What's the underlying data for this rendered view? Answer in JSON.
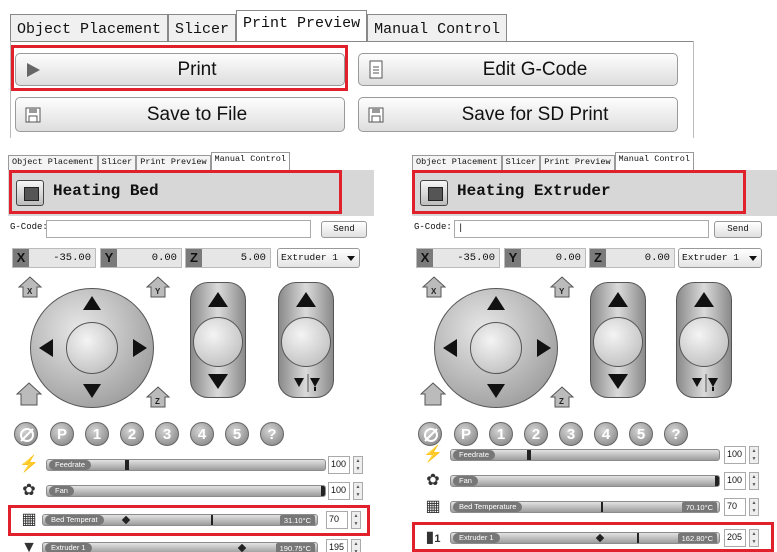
{
  "top": {
    "tabs": [
      {
        "label": "Object Placement"
      },
      {
        "label": "Slicer"
      },
      {
        "label": "Print Preview"
      },
      {
        "label": "Manual Control"
      }
    ],
    "buttons": {
      "print": "Print",
      "edit_gcode": "Edit G-Code",
      "save_file": "Save to File",
      "save_sd": "Save for SD Print"
    }
  },
  "panels": [
    {
      "tabs": [
        "Object Placement",
        "Slicer",
        "Print Preview",
        "Manual Control"
      ],
      "title": "Heating Bed",
      "gcode_label": "G-Code:",
      "gcode_value": "",
      "send": "Send",
      "x": "-35.00",
      "y": "0.00",
      "z": "5.00",
      "extruder": "Extruder 1",
      "pills": [
        "P",
        "1",
        "2",
        "3",
        "4",
        "5",
        "?"
      ],
      "feedrate": {
        "label": "Feedrate",
        "value": "100"
      },
      "fan": {
        "label": "Fan",
        "value": "100"
      },
      "bed": {
        "label": "Bed Temperat",
        "temp": "31.10°C",
        "value": "70"
      },
      "ext": {
        "label": "Extruder 1",
        "temp": "190.75°C",
        "value": "195"
      }
    },
    {
      "tabs": [
        "Object Placement",
        "Slicer",
        "Print Preview",
        "Manual Control"
      ],
      "title": "Heating Extruder",
      "gcode_label": "G-Code:",
      "gcode_value": "|",
      "send": "Send",
      "x": "-35.00",
      "y": "0.00",
      "z": "0.00",
      "extruder": "Extruder 1",
      "pills": [
        "P",
        "1",
        "2",
        "3",
        "4",
        "5",
        "?"
      ],
      "feedrate": {
        "label": "Feedrate",
        "value": "100"
      },
      "fan": {
        "label": "Fan",
        "value": "100"
      },
      "bed": {
        "label": "Bed Temperature",
        "temp": "70.10°C",
        "value": "70"
      },
      "ext": {
        "label": "Extruder 1",
        "temp": "162.80°C",
        "value": "205"
      },
      "ext_row_prefix": "1"
    }
  ],
  "colors": {
    "highlight": "#e0202a",
    "title_bg": "#d7d7d7"
  }
}
